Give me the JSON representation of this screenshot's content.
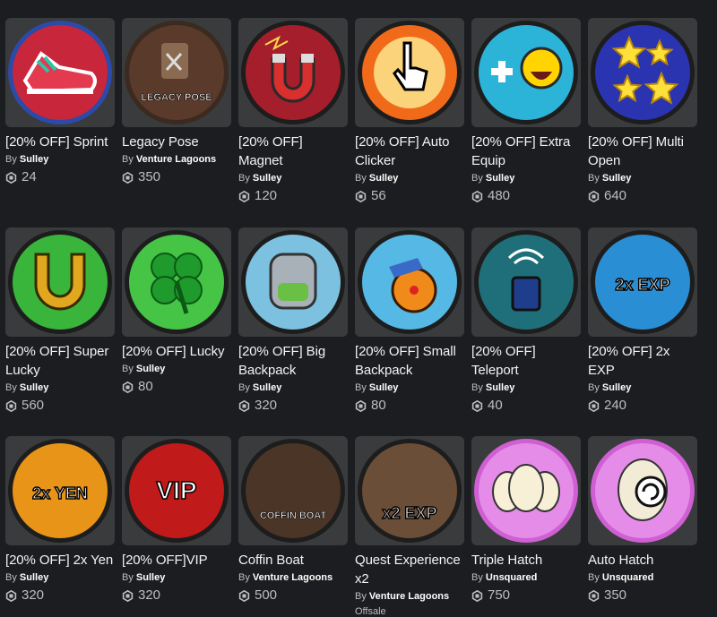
{
  "items": [
    {
      "name": "[20% OFF] Sprint",
      "creator": "Sulley",
      "price": "24",
      "icon": "sprint-shoe-icon",
      "bg": "#c8263b",
      "ring": "#2c4aa8"
    },
    {
      "name": "Legacy Pose",
      "creator": "Venture Lagoons",
      "price": "350",
      "icon": "legacy-pose-icon",
      "bg": "#5a3a2a",
      "ring": "#3b2a20",
      "badge_text": "LEGACY POSE"
    },
    {
      "name": "[20% OFF] Magnet",
      "creator": "Sulley",
      "price": "120",
      "icon": "magnet-icon",
      "bg": "#a41e2c",
      "ring": "#1d1d1d"
    },
    {
      "name": "[20% OFF] Auto Clicker",
      "creator": "Sulley",
      "price": "56",
      "icon": "auto-clicker-icon",
      "bg": "#f06a1a",
      "ring": "#1d1d1d"
    },
    {
      "name": "[20% OFF] Extra Equip",
      "creator": "Sulley",
      "price": "480",
      "icon": "extra-equip-icon",
      "bg": "#2bb3d8",
      "ring": "#1d1d1d"
    },
    {
      "name": "[20% OFF] Multi Open",
      "creator": "Sulley",
      "price": "640",
      "icon": "multi-open-stars-icon",
      "bg": "#2a34b0",
      "ring": "#1d1d1d"
    },
    {
      "name": "[20% OFF] Super Lucky",
      "creator": "Sulley",
      "price": "560",
      "icon": "horseshoe-icon",
      "bg": "#39b53b",
      "ring": "#1d1d1d"
    },
    {
      "name": "[20% OFF] Lucky",
      "creator": "Sulley",
      "price": "80",
      "icon": "clover-icon",
      "bg": "#46c446",
      "ring": "#1d1d1d"
    },
    {
      "name": "[20% OFF] Big Backpack",
      "creator": "Sulley",
      "price": "320",
      "icon": "big-backpack-icon",
      "bg": "#7cc2e0",
      "ring": "#1d1d1d"
    },
    {
      "name": "[20% OFF] Small Backpack",
      "creator": "Sulley",
      "price": "80",
      "icon": "small-backpack-icon",
      "bg": "#56b8e4",
      "ring": "#1d1d1d"
    },
    {
      "name": "[20% OFF] Teleport",
      "creator": "Sulley",
      "price": "40",
      "icon": "teleport-icon",
      "bg": "#1f6f7a",
      "ring": "#1d1d1d"
    },
    {
      "name": "[20% OFF] 2x EXP",
      "creator": "Sulley",
      "price": "240",
      "icon": "exp-2x-icon",
      "bg": "#2a8ed4",
      "ring": "#1d1d1d",
      "badge_text": "2x EXP"
    },
    {
      "name": "[20% OFF] 2x Yen",
      "creator": "Sulley",
      "price": "320",
      "icon": "yen-2x-icon",
      "bg": "#e89418",
      "ring": "#1d1d1d",
      "badge_text": "2x YEN"
    },
    {
      "name": "[20% OFF]VIP",
      "creator": "Sulley",
      "price": "320",
      "icon": "vip-icon",
      "bg": "#c01a1a",
      "ring": "#1d1d1d",
      "badge_text": "VIP"
    },
    {
      "name": "Coffin Boat",
      "creator": "Venture Lagoons",
      "price": "500",
      "icon": "coffin-boat-icon",
      "bg": "#4a3526",
      "ring": "#1d1d1d",
      "badge_text": "COFFIN BOAT"
    },
    {
      "name": "Quest Experience x2",
      "creator": "Venture Lagoons",
      "price": "",
      "offsale": "Offsale",
      "icon": "quest-exp-icon",
      "bg": "#6b4e38",
      "ring": "#1d1d1d",
      "badge_text": "x2 EXP"
    },
    {
      "name": "Triple Hatch",
      "creator": "Unsquared",
      "price": "750",
      "icon": "triple-hatch-eggs-icon",
      "bg": "#e58ce8",
      "ring": "#cf5fd3"
    },
    {
      "name": "Auto Hatch",
      "creator": "Unsquared",
      "price": "350",
      "icon": "auto-hatch-egg-icon",
      "bg": "#e58ce8",
      "ring": "#cf5fd3"
    }
  ],
  "by_prefix": "By"
}
